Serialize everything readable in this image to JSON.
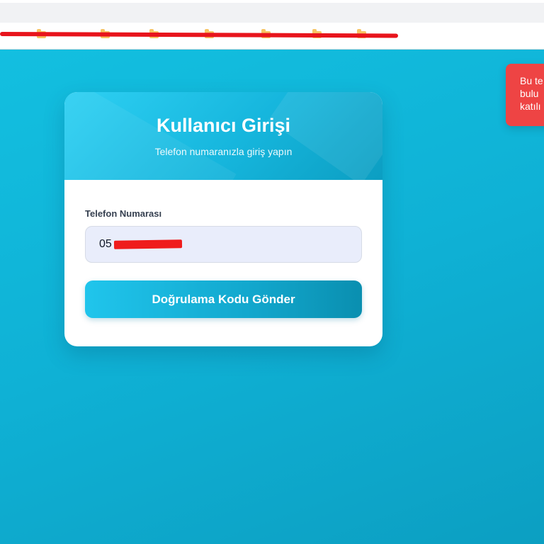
{
  "login": {
    "title": "Kullanıcı Girişi",
    "subtitle": "Telefon numaranızla giriş yapın",
    "phone_label": "Telefon Numarası",
    "phone_value": "05",
    "submit_label": "Doğrulama Kodu Gönder"
  },
  "toast": {
    "line1": "Bu te",
    "line2": "bulu",
    "line3": "katılı"
  },
  "colors": {
    "background": "#0fb3d6",
    "toast": "#ee4444",
    "redaction": "#e8141c"
  }
}
